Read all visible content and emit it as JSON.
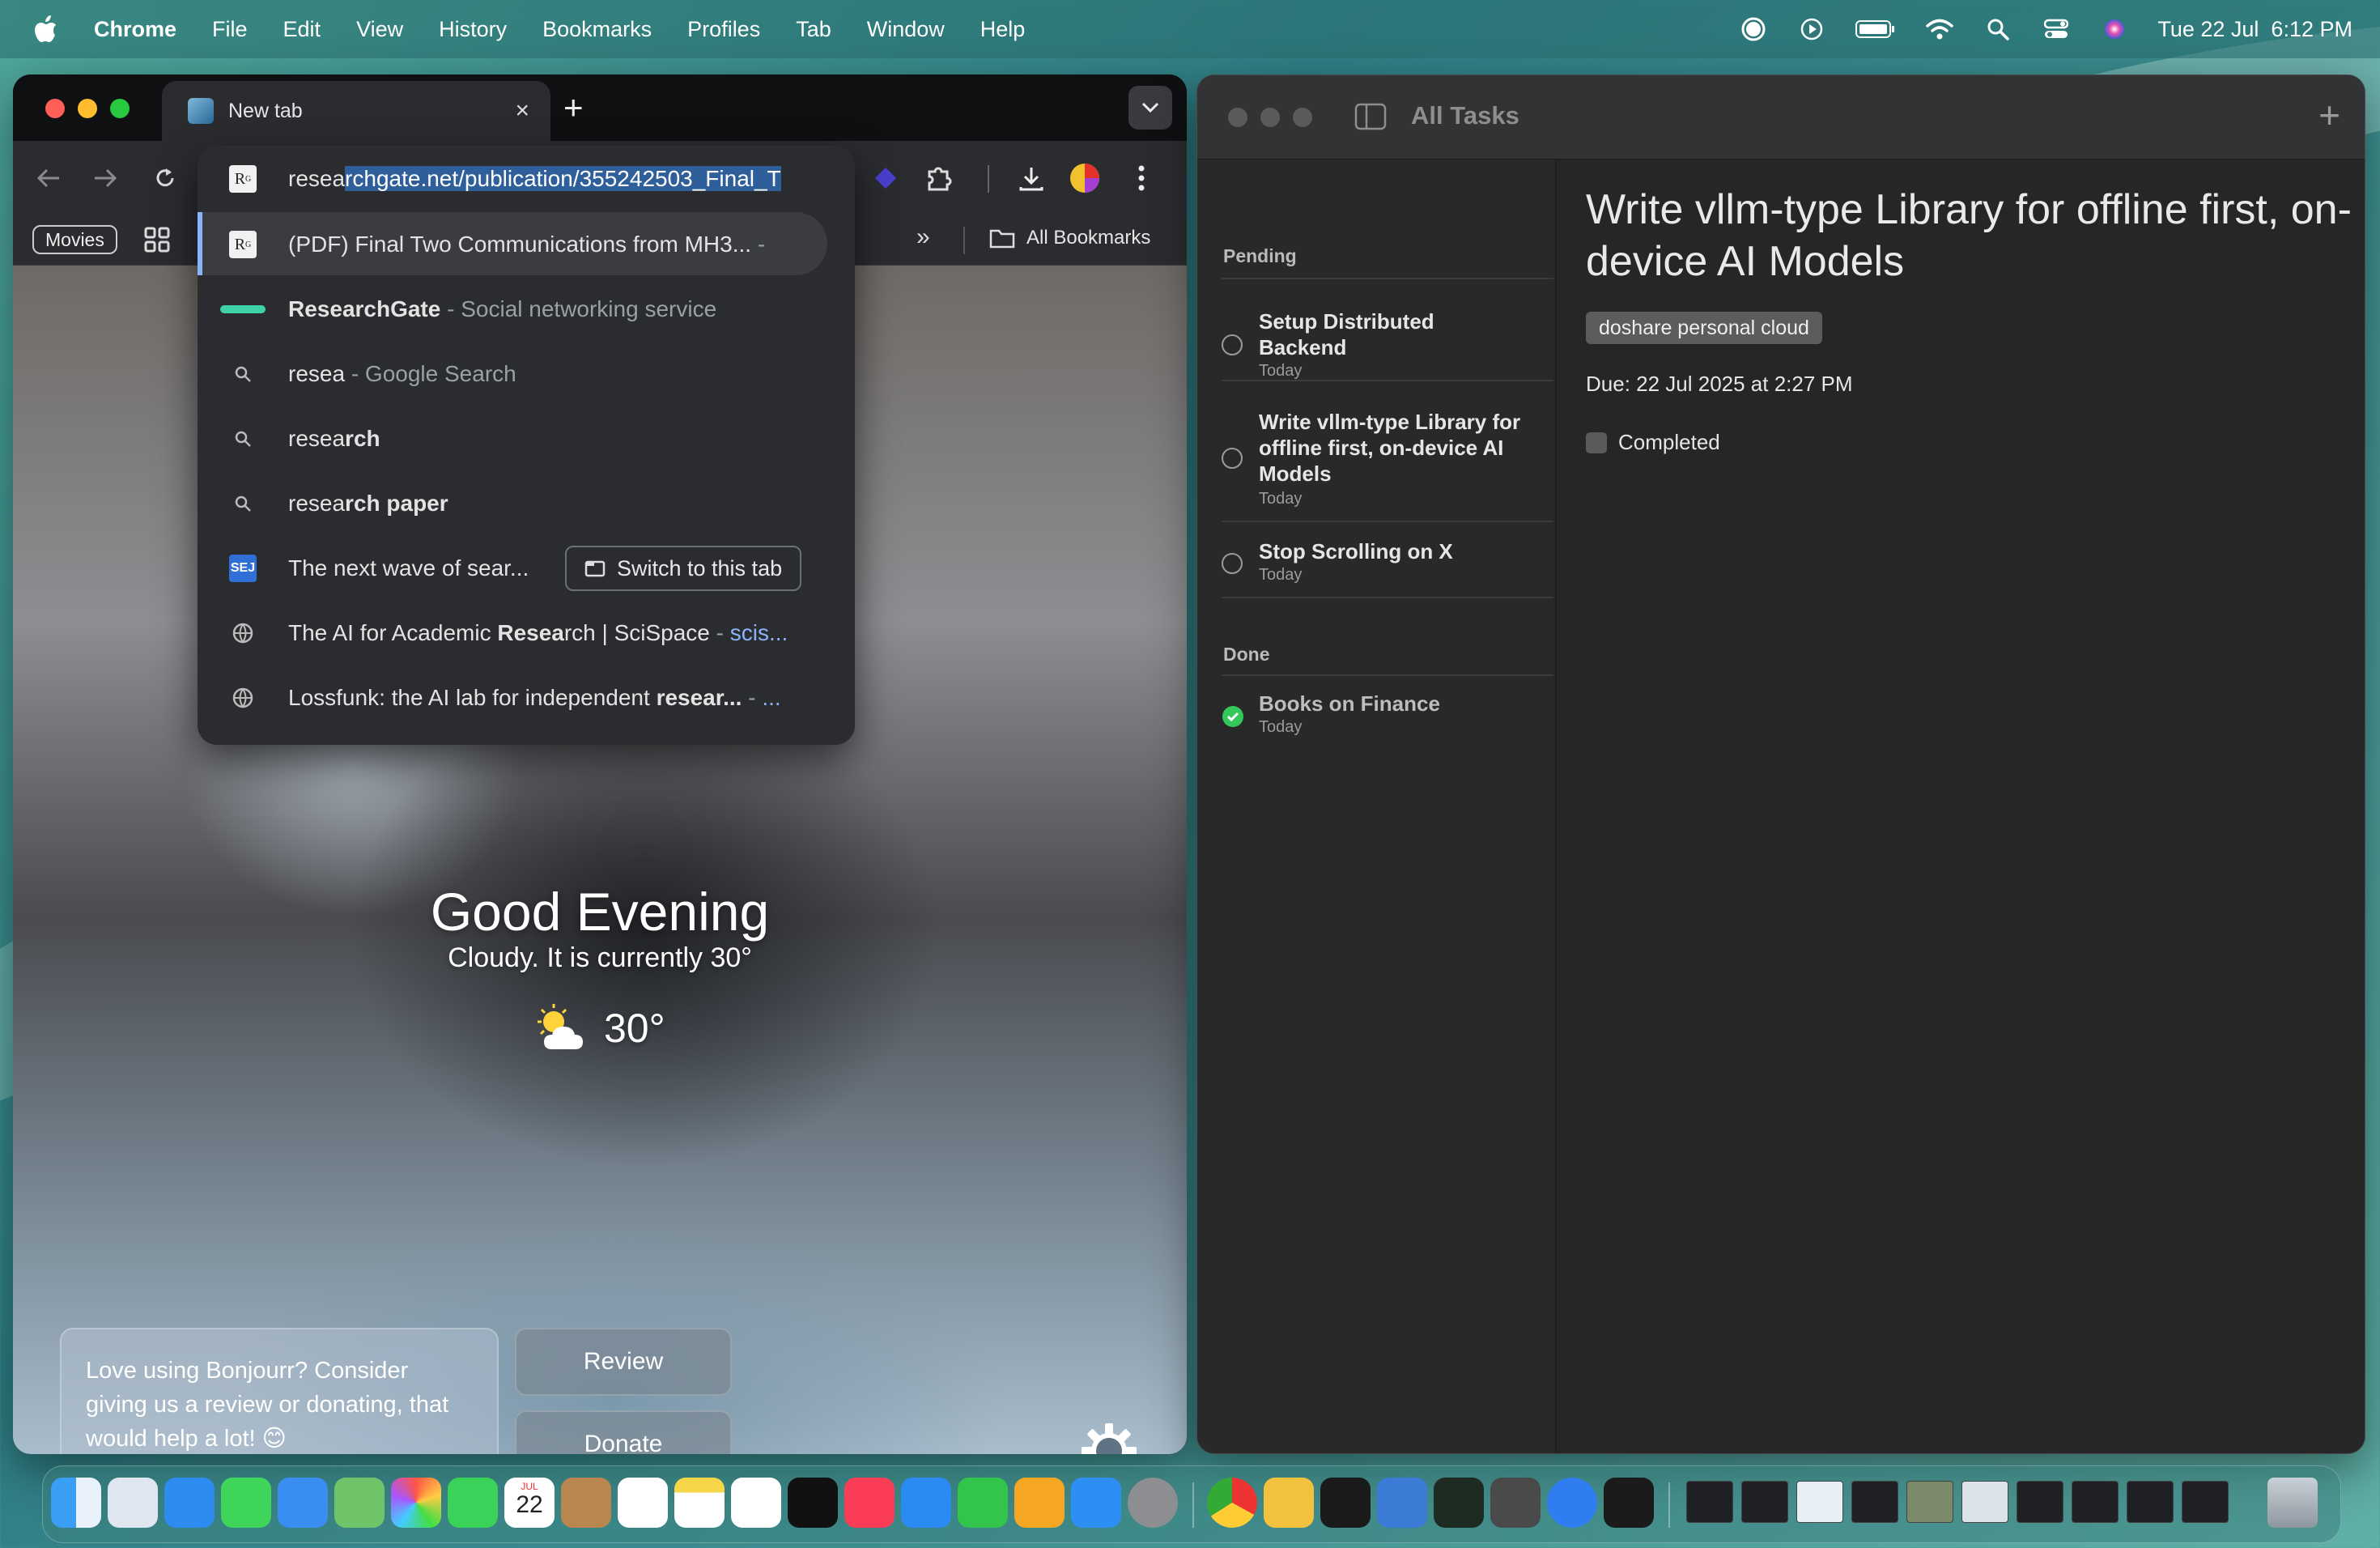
{
  "menubar": {
    "app": "Chrome",
    "items": [
      "File",
      "Edit",
      "View",
      "History",
      "Bookmarks",
      "Profiles",
      "Tab",
      "Window",
      "Help"
    ],
    "datetime": "Tue 22 Jul  6:12 PM"
  },
  "chrome": {
    "tab_title": "New tab",
    "new_tab": "+",
    "close_tab": "×",
    "address_typed": "resea",
    "address_completion": "rchgate.net/publication/355242503_Final_T",
    "bookmarks": {
      "movies": "Movies",
      "overflow": "»",
      "all_bookmarks": "All Bookmarks"
    },
    "omnibox": {
      "rows": [
        {
          "icon": "researchgate-icon",
          "main": "(PDF) Final Two Communications from MH3...",
          "suffix": " -"
        },
        {
          "icon": "researchgate-bar-icon",
          "main": "ResearchGate",
          "suffix": " - Social networking service"
        },
        {
          "icon": "search-icon",
          "main": "resea",
          "suffix": " - Google Search"
        },
        {
          "icon": "search-icon",
          "main_pre": "resea",
          "main_bold": "rch"
        },
        {
          "icon": "search-icon",
          "main_pre": "resea",
          "main_bold": "rch paper"
        },
        {
          "icon": "sej-icon",
          "main": "The next wave of sear...",
          "button": "Switch to this tab"
        },
        {
          "icon": "globe-icon",
          "pre": "The AI for Academic ",
          "bold": "Resea",
          "post": "rch | SciSpace",
          "suffix": " - ",
          "link": "scis..."
        },
        {
          "icon": "globe-icon",
          "pre": "Lossfunk: the AI lab for independent ",
          "bold": "resear...",
          "suffix": " - ",
          "link": "..."
        }
      ]
    },
    "newtab": {
      "greeting": "Good Evening",
      "weather_line": "Cloudy. It is currently 30°",
      "temperature": "30°",
      "card_text": "Love using Bonjourr? Consider giving us a review or donating, that would help a lot! 😊",
      "review": "Review",
      "donate": "Donate"
    }
  },
  "tasks": {
    "title": "All Tasks",
    "add": "+",
    "pending_label": "Pending",
    "done_label": "Done",
    "pending": [
      {
        "name": "Setup Distributed Backend",
        "date": "Today"
      },
      {
        "name": "Write vllm-type Library for offline first, on-device AI Models",
        "date": "Today"
      },
      {
        "name": "Stop Scrolling on X",
        "date": "Today"
      }
    ],
    "done": [
      {
        "name": "Books on Finance",
        "date": "Today"
      }
    ],
    "detail": {
      "title": "Write vllm-type Library for offline first, on-device AI Models",
      "tag": "doshare personal cloud",
      "due": "Due: 22 Jul 2025 at 2:27 PM",
      "completed_label": "Completed"
    }
  },
  "dock": {
    "calendar_month": "JUL",
    "calendar_day": "22"
  },
  "colors": {
    "chrome_bg": "#2b2c2f",
    "omnibox_selection": "#2f5f9a",
    "done_check": "#34c759",
    "link": "#8ab4f8"
  }
}
